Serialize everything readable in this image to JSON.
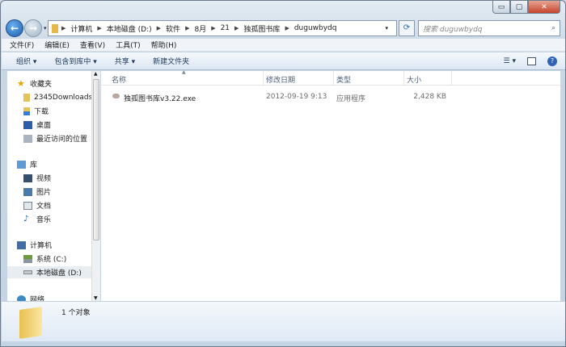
{
  "window": {
    "minimize": "▭",
    "maximize": "▢",
    "close": "✕"
  },
  "address": {
    "crumbs": [
      "计算机",
      "本地磁盘 (D:)",
      "软件",
      "8月",
      "21",
      "独孤图书库",
      "duguwbydq"
    ]
  },
  "search": {
    "placeholder": "搜索 duguwbydq"
  },
  "menu": [
    "文件(F)",
    "编辑(E)",
    "查看(V)",
    "工具(T)",
    "帮助(H)"
  ],
  "toolbar": [
    "组织 ▾",
    "包含到库中 ▾",
    "共享 ▾",
    "新建文件夹"
  ],
  "sidebar": {
    "favorites": {
      "label": "收藏夹",
      "items": [
        "2345Downloads",
        "下载",
        "桌面",
        "最近访问的位置"
      ]
    },
    "libraries": {
      "label": "库",
      "items": [
        "视频",
        "图片",
        "文档",
        "音乐"
      ]
    },
    "computer": {
      "label": "计算机",
      "items": [
        "系统 (C:)",
        "本地磁盘 (D:)"
      ]
    },
    "network": {
      "label": "网络"
    }
  },
  "columns": [
    "名称",
    "修改日期",
    "类型",
    "大小"
  ],
  "files": [
    {
      "name": "独孤图书库v3.22.exe",
      "date": "2012-09-19 9:13",
      "type": "应用程序",
      "size": "2,428 KB"
    }
  ],
  "status": {
    "count": "1 个对象"
  }
}
